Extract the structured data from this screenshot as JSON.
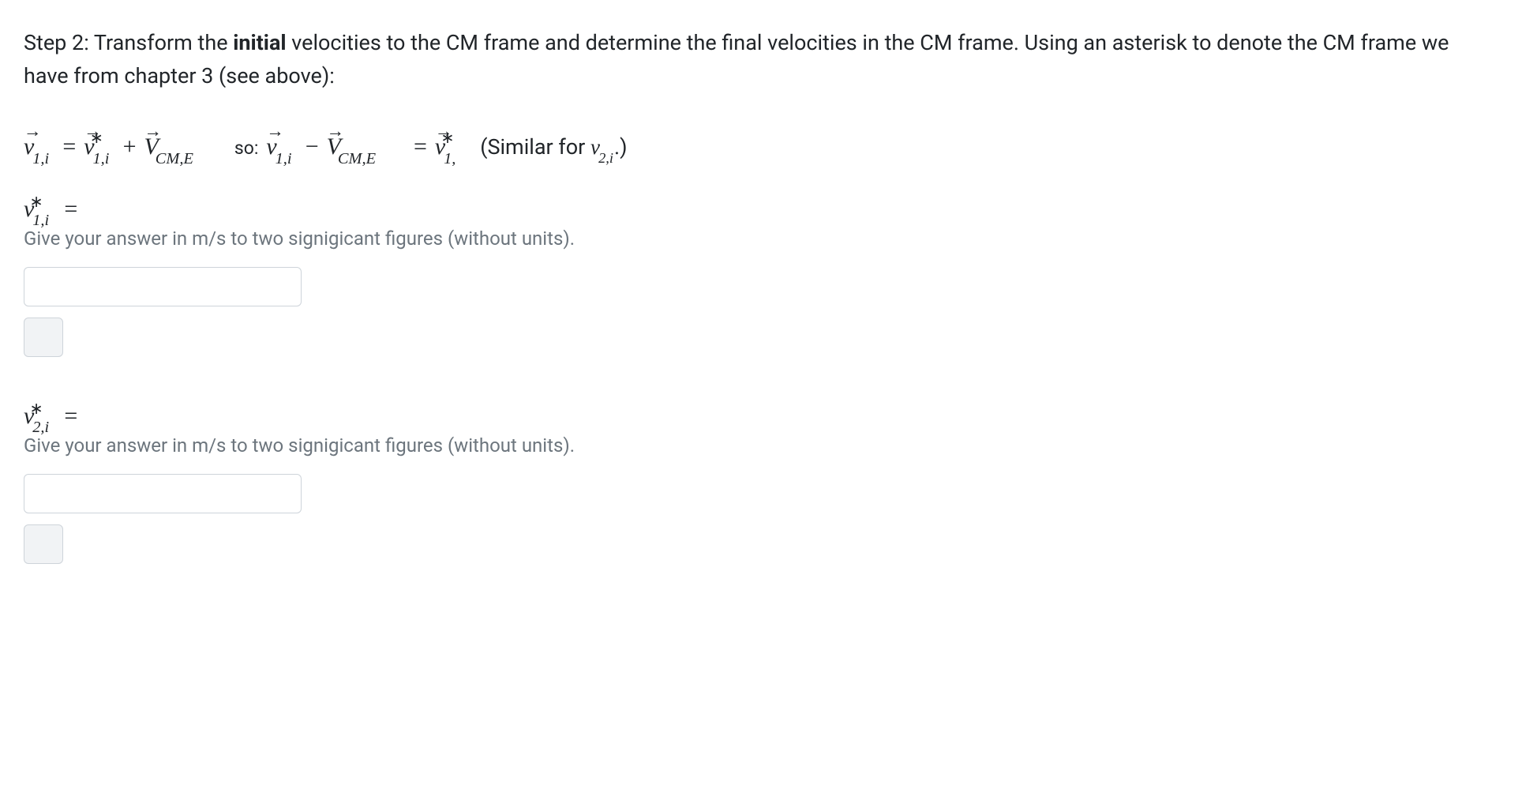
{
  "intro": {
    "prefix": "Step 2: Transform the ",
    "bold": "initial",
    "suffix": " velocities to the CM frame and determine the final velocities in the CM frame. Using an asterisk to denote the CM frame we have from chapter 3 (see above):"
  },
  "equation": {
    "so_text": "so:",
    "similar_prefix": "(Similar for ",
    "similar_var": "v",
    "similar_sub": "2,i",
    "similar_suffix": ".)",
    "v": "v",
    "V": "V",
    "sub_1i": "1,i",
    "sub_1comma": "1,",
    "sub_CME": "CM,E",
    "star": "∗",
    "arrow": "→",
    "eq": "=",
    "plus": "+",
    "minus": "−"
  },
  "questions": [
    {
      "var": "v",
      "sub": "1,i",
      "hint": "Give your answer in m/s to two signigicant figures (without units).",
      "value": ""
    },
    {
      "var": "v",
      "sub": "2,i",
      "hint": "Give your answer in m/s to two signigicant figures (without units).",
      "value": ""
    }
  ]
}
